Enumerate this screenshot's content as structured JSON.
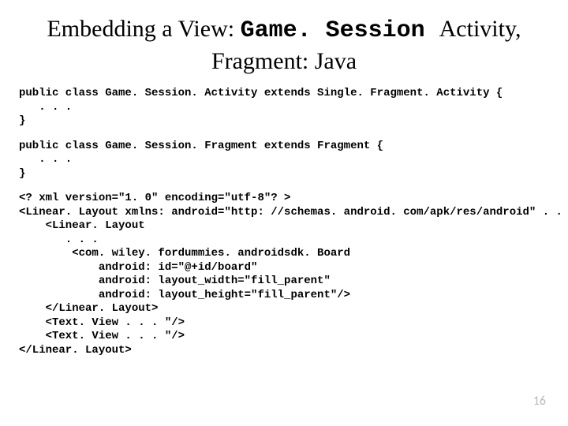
{
  "title": {
    "part1": "Embedding a View: ",
    "mono": "Game. Session ",
    "part2": "Activity,",
    "line2": "Fragment: Java"
  },
  "code1": "public class Game. Session. Activity extends Single. Fragment. Activity {\n   . . .\n}",
  "code2": "public class Game. Session. Fragment extends Fragment {\n   . . .\n}",
  "code3": "<? xml version=\"1. 0\" encoding=\"utf-8\"? >\n<Linear. Layout xmlns: android=\"http: //schemas. android. com/apk/res/android\" . . >\n    <Linear. Layout\n       . . .\n        <com. wiley. fordummies. androidsdk. Board\n            android: id=\"@+id/board\"\n            android: layout_width=\"fill_parent\"\n            android: layout_height=\"fill_parent\"/>\n    </Linear. Layout>\n    <Text. View . . . \"/>\n    <Text. View . . . \"/>\n</Linear. Layout>",
  "pageNumber": "16"
}
